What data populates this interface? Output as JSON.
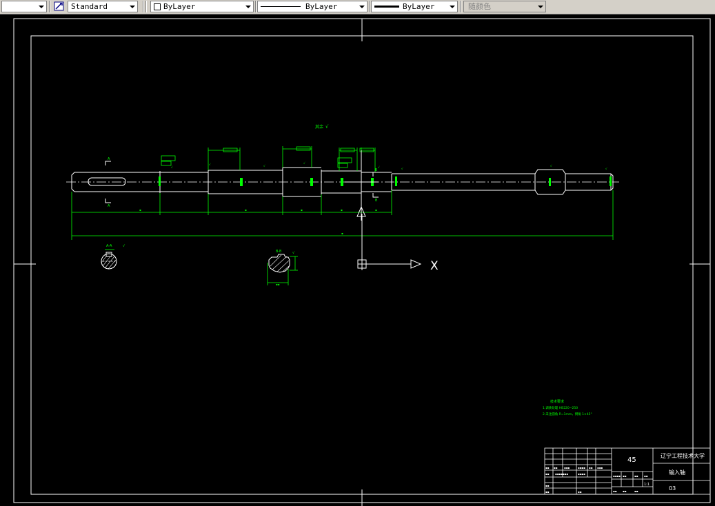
{
  "toolbar": {
    "text_style": "Standard",
    "layer_color": "ByLayer",
    "linetype": "ByLayer",
    "lineweight": "ByLayer",
    "plot_style": "随颜色"
  },
  "drawing": {
    "surface_note": "其余",
    "tech_requirements": {
      "title": "技术要求",
      "line1": "1.调质处理 HB220~250",
      "line2": "2.未注圆角 R=1mm，倒角 1×45°"
    },
    "title_block": {
      "material": "45",
      "school": "辽宁工程技术大学",
      "part_name": "输入轴",
      "drawing_no": "03",
      "scale": "1:1"
    }
  },
  "ucs": {
    "x_label": "X"
  },
  "colors": {
    "lines": "#00ff00",
    "part": "#ffffff",
    "background": "#000000"
  }
}
